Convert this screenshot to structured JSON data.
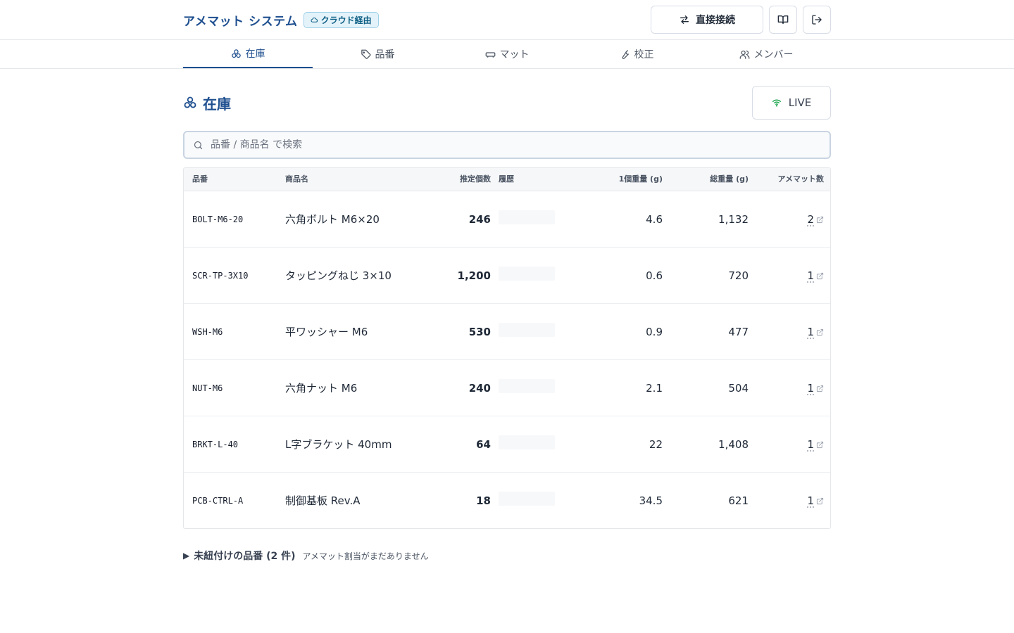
{
  "header": {
    "title": "アメマット システム",
    "mode_badge": "クラウド経由",
    "direct_connect_label": "直接接続"
  },
  "tabs": [
    {
      "label": "在庫",
      "icon": "boxes-icon",
      "active": true
    },
    {
      "label": "品番",
      "icon": "tag-icon",
      "active": false
    },
    {
      "label": "マット",
      "icon": "mat-icon",
      "active": false
    },
    {
      "label": "校正",
      "icon": "wrench-icon",
      "active": false
    },
    {
      "label": "メンバー",
      "icon": "users-icon",
      "active": false
    }
  ],
  "page": {
    "title": "在庫",
    "live_label": "LIVE"
  },
  "search": {
    "placeholder": "品番 / 商品名 で検索",
    "value": ""
  },
  "table": {
    "columns": [
      "品番",
      "商品名",
      "推定個数",
      "履歴",
      "1個重量 (g)",
      "総重量 (g)",
      "アメマット数"
    ],
    "rows": [
      {
        "code": "BOLT-M6-20",
        "name": "六角ボルト M6×20",
        "qty": "246",
        "unit_weight": "4.6",
        "total_weight": "1,132",
        "mats": "2"
      },
      {
        "code": "SCR-TP-3X10",
        "name": "タッピングねじ 3×10",
        "qty": "1,200",
        "unit_weight": "0.6",
        "total_weight": "720",
        "mats": "1"
      },
      {
        "code": "WSH-M6",
        "name": "平ワッシャー M6",
        "qty": "530",
        "unit_weight": "0.9",
        "total_weight": "477",
        "mats": "1"
      },
      {
        "code": "NUT-M6",
        "name": "六角ナット M6",
        "qty": "240",
        "unit_weight": "2.1",
        "total_weight": "504",
        "mats": "1"
      },
      {
        "code": "BRKT-L-40",
        "name": "L字ブラケット 40mm",
        "qty": "64",
        "unit_weight": "22",
        "total_weight": "1,408",
        "mats": "1"
      },
      {
        "code": "PCB-CTRL-A",
        "name": "制御基板 Rev.A",
        "qty": "18",
        "unit_weight": "34.5",
        "total_weight": "621",
        "mats": "1"
      }
    ]
  },
  "unlinked": {
    "label": "未紐付けの品番 (2 件)",
    "note": "アメマット割当がまだありません"
  },
  "colors": {
    "accent": "#1e4f8f",
    "badge_bg": "#e4f3fa",
    "live_green": "#16a34a"
  }
}
